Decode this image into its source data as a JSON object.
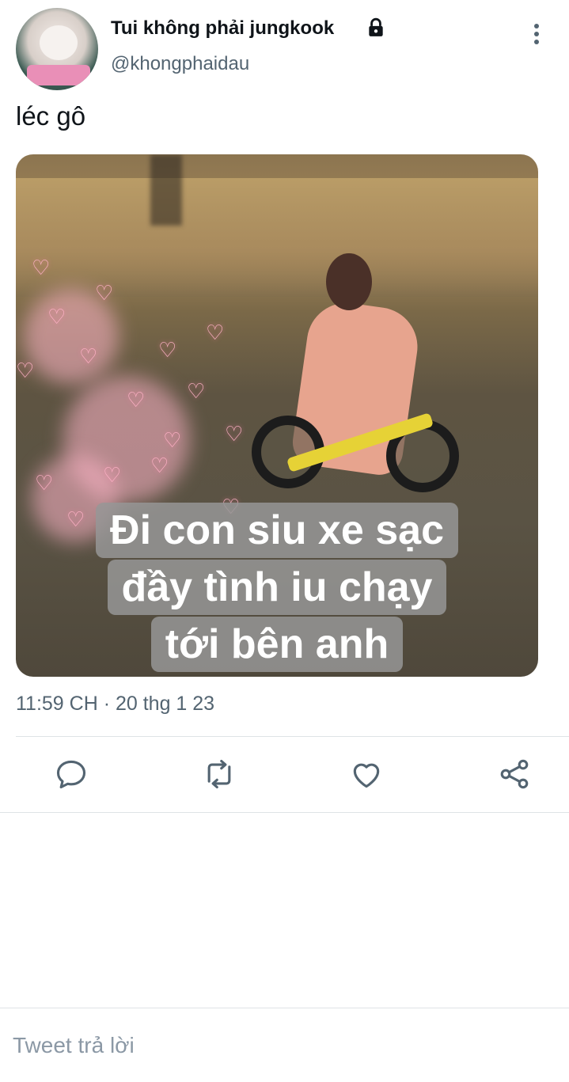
{
  "user": {
    "display_name": "Tui không phải jungkook",
    "handle": "@khongphaidau",
    "protected_icon": "lock-icon",
    "avatar_icon": "avatar-image"
  },
  "tweet": {
    "text": "léc gô",
    "media_caption": [
      "Đi con siu xe sạc",
      "đầy tình iu chạy",
      "tới bên anh"
    ],
    "timestamp": "11:59 CH · 20 thg 1 23"
  },
  "actions": [
    {
      "name": "reply",
      "icon": "comment-icon"
    },
    {
      "name": "retweet",
      "icon": "retweet-icon"
    },
    {
      "name": "like",
      "icon": "heart-icon"
    },
    {
      "name": "share",
      "icon": "share-icon"
    }
  ],
  "reply_bar": {
    "placeholder": "Tweet trả lời"
  },
  "colors": {
    "text": "#0f1419",
    "secondary": "#536471",
    "divider": "#dfe3e6",
    "placeholder": "#8b98a5"
  }
}
